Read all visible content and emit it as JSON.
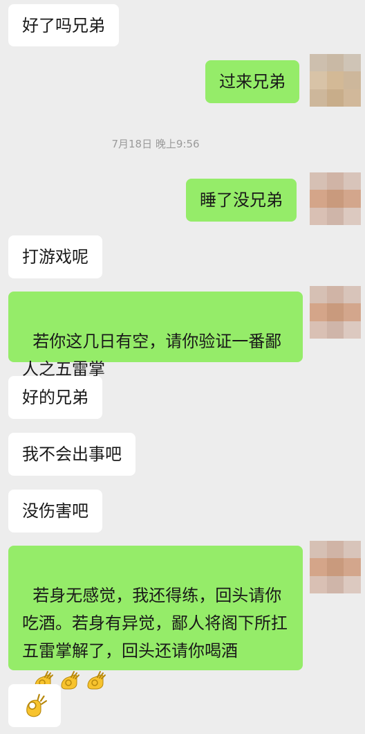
{
  "colors": {
    "background": "#ededed",
    "incoming_bubble": "#ffffff",
    "outgoing_bubble": "#95ec69",
    "timestamp_text": "#9a9a9a"
  },
  "timestamp": "7月18日 晚上9:56",
  "messages": [
    {
      "direction": "in",
      "text": "好了吗兄弟"
    },
    {
      "direction": "out",
      "text": "过来兄弟"
    },
    {
      "direction": "out",
      "text": "睡了没兄弟"
    },
    {
      "direction": "in",
      "text": "打游戏呢"
    },
    {
      "direction": "out",
      "text": "若你这几日有空，请你验证一番鄙人之五雷掌"
    },
    {
      "direction": "in",
      "text": "好的兄弟"
    },
    {
      "direction": "in",
      "text": "我不会出事吧"
    },
    {
      "direction": "in",
      "text": "没伤害吧"
    },
    {
      "direction": "out",
      "text": "若身无感觉，我还得练，回头请你吃酒。若身有异觉，鄙人将阁下所扛五雷掌解了，回头还请你喝酒",
      "emoji": [
        "ok-hand-icon",
        "ok-hand-icon",
        "ok-hand-icon"
      ]
    },
    {
      "direction": "in",
      "emoji": [
        "ok-hand-icon"
      ]
    }
  ],
  "avatar": {
    "icon": "blurred-avatar"
  }
}
